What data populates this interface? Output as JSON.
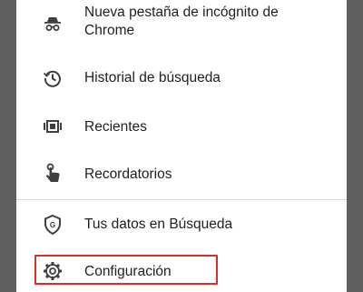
{
  "menu": {
    "items": [
      {
        "label_line1": "Nueva pestaña de incógnito de",
        "label_line2": "Chrome",
        "icon": "incognito-icon"
      },
      {
        "label": "Historial de búsqueda",
        "icon": "history-icon"
      },
      {
        "label": "Recientes",
        "icon": "recents-icon"
      },
      {
        "label": "Recordatorios",
        "icon": "reminders-icon"
      },
      {
        "label": "Tus datos en Búsqueda",
        "icon": "privacy-shield-icon"
      },
      {
        "label": "Configuración",
        "icon": "gear-icon"
      }
    ]
  },
  "colors": {
    "text": "#202124",
    "icon": "#3c4043",
    "highlight_border": "#d93025",
    "divider": "#dadce0",
    "backdrop": "#5f5f5f"
  }
}
